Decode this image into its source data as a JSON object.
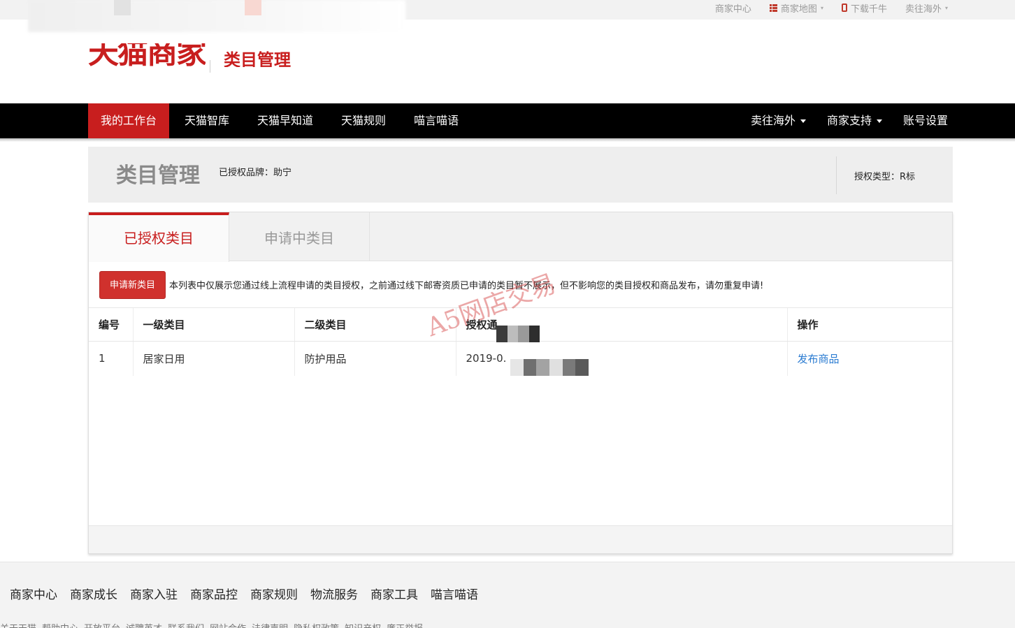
{
  "topbar": {
    "links": [
      {
        "label": "商家中心",
        "icon": "",
        "caret": false
      },
      {
        "label": "商家地图",
        "icon": "list-icon",
        "caret": true
      },
      {
        "label": "下载千牛",
        "icon": "phone-icon",
        "caret": false
      },
      {
        "label": "卖往海外",
        "icon": "",
        "caret": true
      }
    ]
  },
  "header": {
    "logo_text": "天猫商家",
    "subtitle": "类目管理"
  },
  "nav": {
    "left": [
      "我的工作台",
      "天猫智库",
      "天猫早知道",
      "天猫规则",
      "喵言喵语"
    ],
    "right": [
      {
        "label": "卖往海外",
        "caret": true
      },
      {
        "label": "商家支持",
        "caret": true
      },
      {
        "label": "账号设置",
        "caret": false
      }
    ]
  },
  "page_header": {
    "title": "类目管理",
    "brand": "已授权品牌：助宁",
    "auth_type": "授权类型：R标"
  },
  "tabs": [
    "已授权类目",
    "申请中类目"
  ],
  "notice": {
    "button": "申请新类目",
    "text": "本列表中仅展示您通过线上流程申请的类目授权，之前通过线下邮寄资质已申请的类目暂不展示，但不影响您的类目授权和商品发布，请勿重复申请!"
  },
  "table": {
    "headers": [
      "编号",
      "一级类目",
      "二级类目",
      "授权通",
      "操作"
    ],
    "rows": [
      {
        "id": "1",
        "level1": "居家日用",
        "level2": "防护用品",
        "date": "2019-0.",
        "action": "发布商品"
      }
    ]
  },
  "watermark": "A5网店交易",
  "footer": {
    "links": [
      "商家中心",
      "商家成长",
      "商家入驻",
      "商家品控",
      "商家规则",
      "物流服务",
      "商家工具",
      "喵言喵语"
    ],
    "links2": [
      "关于天猫",
      "帮助中心",
      "开放平台",
      "诚聘英才",
      "联系我们",
      "网站合作",
      "法律声明",
      "隐私权政策",
      "知识产权",
      "廉正举报"
    ]
  },
  "colors": {
    "brand_red": "#c81e1e",
    "nav_bg": "#000000",
    "link_blue": "#2a7bd1"
  }
}
